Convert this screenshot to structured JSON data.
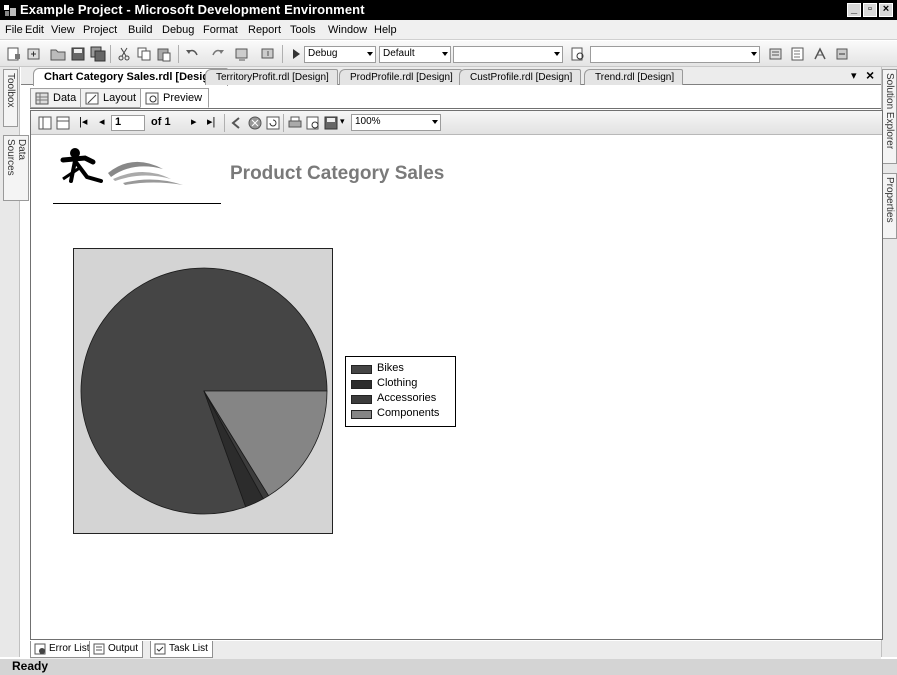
{
  "window": {
    "title": "Example Project - Microsoft Development Environment"
  },
  "menu": [
    "File",
    "Edit",
    "View",
    "Project",
    "Build",
    "Debug",
    "Format",
    "Report",
    "Tools",
    "Window",
    "Help"
  ],
  "toolbar": {
    "config": "Debug",
    "platform": "Default"
  },
  "doc_tabs": [
    "Chart Category Sales.rdl [Design]",
    "TerritoryProfit.rdl [Design]",
    "ProdProfile.rdl [Design]",
    "CustProfile.rdl [Design]",
    "Trend.rdl [Design]"
  ],
  "sub_tabs": [
    "Data",
    "Layout",
    "Preview"
  ],
  "left_panels": [
    "Toolbox",
    "Data Sources"
  ],
  "right_panels": [
    "Solution Explorer",
    "Properties"
  ],
  "report_toolbar": {
    "page": "1",
    "of": "of 1",
    "zoom": "100%"
  },
  "report": {
    "title": "Product Category Sales"
  },
  "chart_data": {
    "type": "pie",
    "categories": [
      "Bikes",
      "Clothing",
      "Accessories",
      "Components"
    ],
    "values": [
      80.5,
      2.5,
      0.8,
      16.2
    ],
    "colors": [
      "#454545",
      "#2c2c2c",
      "#3c3c3c",
      "#858585"
    ],
    "legend_position": "right"
  },
  "bottom_tabs": [
    "Error List",
    "Output",
    "Task List"
  ],
  "status": "Ready",
  "colors": {
    "title_bar": "#000000",
    "report_title": "#7a7a7a",
    "chart_bg": "#d4d4d4"
  }
}
